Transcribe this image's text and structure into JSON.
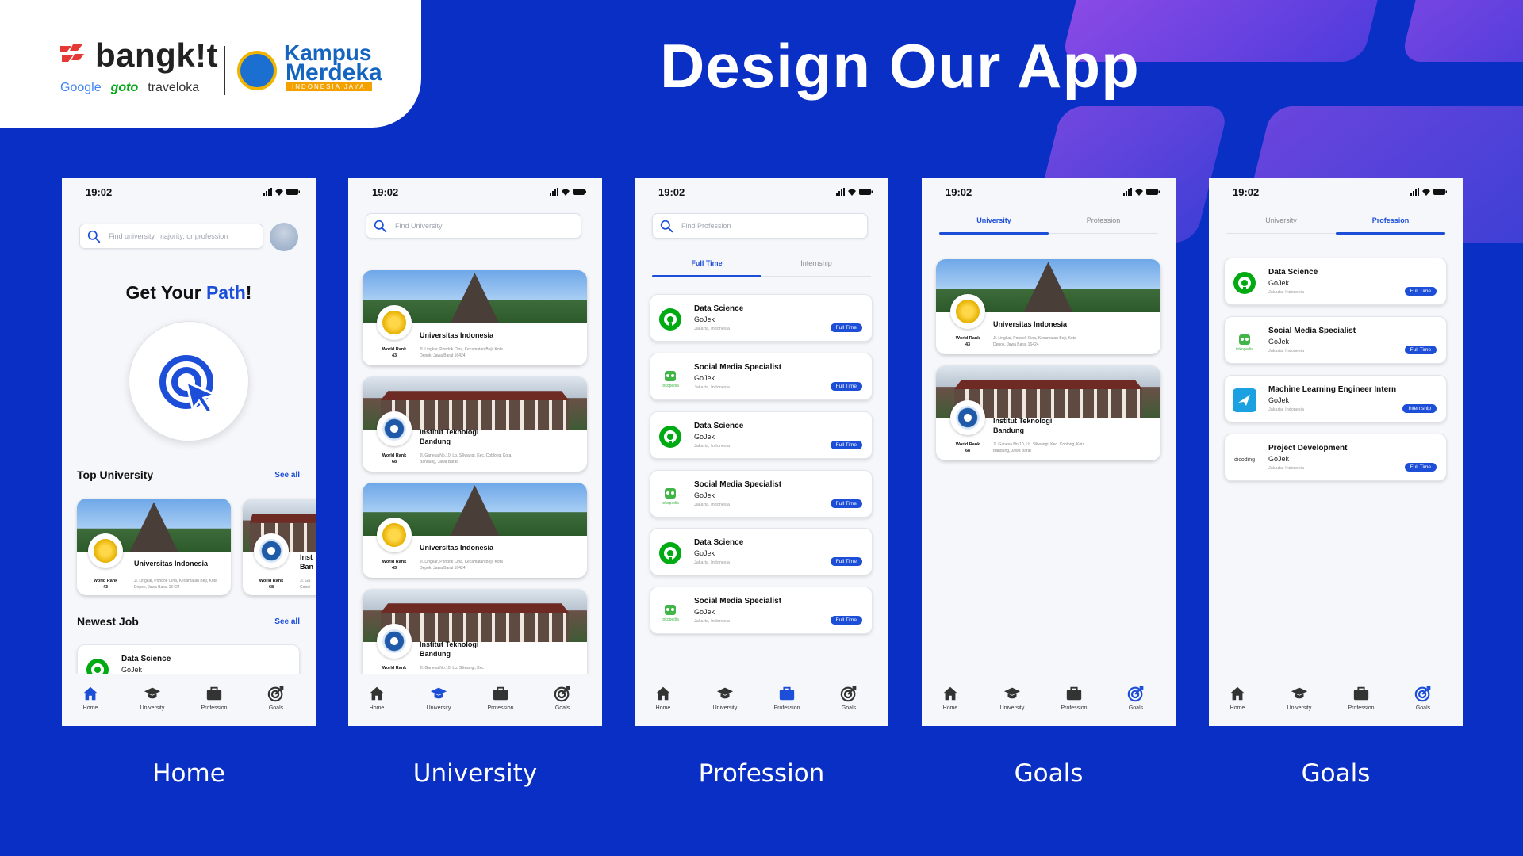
{
  "slide_title": "Design Our App",
  "brand": {
    "bangkit": "bangk!t",
    "partners": [
      "Google",
      "goto",
      "traveloka"
    ],
    "kampus_line1": "Kampus",
    "kampus_line2": "Merdeka",
    "kampus_tagline": "INDONESIA JAYA"
  },
  "colors": {
    "background": "#0a2fc4",
    "accent": "#1d4ed8",
    "badge": "#1d4ed8",
    "goals_gradient": "#8f4be6"
  },
  "common": {
    "time": "19:02",
    "nav": [
      "Home",
      "University",
      "Profession",
      "Goals"
    ],
    "nav_icons": [
      "home-icon",
      "graduation-cap-icon",
      "briefcase-icon",
      "target-icon"
    ]
  },
  "home": {
    "caption": "Home",
    "search_placeholder": "Find university, majority, or profession",
    "headline_a": "Get Your ",
    "headline_b": "Path",
    "headline_c": "!",
    "top_university": "Top University",
    "newest_job": "Newest Job",
    "see_all": "See all",
    "card1": {
      "name": "Universitas Indonesia",
      "rank_label": "World Rank",
      "rank": "43",
      "address": "Jl. Lingkar, Pondok Cina, Kecamatan Beji, Kota Depok, Jawa Barat 16424"
    },
    "card2": {
      "name": "Inst Ban",
      "rank_label": "World Rank",
      "rank": "68",
      "address": "Jl. Ga Coboi"
    },
    "job": {
      "title": "Data Science",
      "company": "GoJek"
    }
  },
  "university": {
    "caption": "University",
    "search_placeholder": "Find University",
    "cards": [
      {
        "name": "Universitas Indonesia",
        "rank_label": "World Rank",
        "rank": "43",
        "address": "Jl. Lingkar, Pondok Cina, Kecamatan Beji, Kota Depok, Jawa Barat 16424"
      },
      {
        "name": "Institut Teknologi Bandung",
        "rank_label": "World Rank",
        "rank": "68",
        "address": "Jl. Ganesa No.10, Lb. Siliwangi, Kec. Coblong, Kota Bandung, Jawa Barat"
      },
      {
        "name": "Universitas Indonesia",
        "rank_label": "World Rank",
        "rank": "43",
        "address": "Jl. Lingkar, Pondok Cina, Kecamatan Beji, Kota Depok, Jawa Barat 16424"
      },
      {
        "name": "Institut Teknologi Bandung",
        "rank_label": "World Rank",
        "rank": "",
        "address": "Jl. Ganesa No.10, Lb. Siliwangi, Kec"
      }
    ]
  },
  "profession": {
    "caption": "Profession",
    "search_placeholder": "Find Profession",
    "tab_full_time": "Full Time",
    "tab_internship": "Internship",
    "jobs": [
      {
        "title": "Data Science",
        "company": "GoJek",
        "location": "Jakarta, Indonesia",
        "badge": "Full Time",
        "logo": "gojek-icon"
      },
      {
        "title": "Social Media Specialist",
        "company": "GoJek",
        "location": "Jakarta, Indonesia",
        "badge": "Full Time",
        "logo": "tokopedia-icon"
      },
      {
        "title": "Data Science",
        "company": "GoJek",
        "location": "Jakarta, Indonesia",
        "badge": "Full Time",
        "logo": "gojek-icon"
      },
      {
        "title": "Social Media Specialist",
        "company": "GoJek",
        "location": "Jakarta, Indonesia",
        "badge": "Full Time",
        "logo": "tokopedia-icon"
      },
      {
        "title": "Data Science",
        "company": "GoJek",
        "location": "Jakarta, Indonesia",
        "badge": "Full Time",
        "logo": "gojek-icon"
      },
      {
        "title": "Social Media Specialist",
        "company": "GoJek",
        "location": "Jakarta, Indonesia",
        "badge": "Full Time",
        "logo": "tokopedia-icon"
      }
    ]
  },
  "goals_university": {
    "caption": "Goals",
    "tab_university": "University",
    "tab_profession": "Profession",
    "cards": [
      {
        "name": "Universitas Indonesia",
        "rank_label": "World Rank",
        "rank": "43",
        "address": "Jl. Lingkar, Pondok Cina, Kecamatan Beji, Kota Depok, Jawa Barat 16424"
      },
      {
        "name": "Institut Teknologi Bandung",
        "rank_label": "World Rank",
        "rank": "68",
        "address": "Jl. Ganesa No.10, Lb. Siliwangi, Kec. Coblong, Kota Bandung, Jawa Barat"
      }
    ]
  },
  "goals_profession": {
    "caption": "Goals",
    "tab_university": "University",
    "tab_profession": "Profession",
    "jobs": [
      {
        "title": "Data Science",
        "company": "GoJek",
        "location": "Jakarta, Indonesia",
        "badge": "Full Time",
        "logo": "gojek-icon"
      },
      {
        "title": "Social Media Specialist",
        "company": "GoJek",
        "location": "Jakarta, Indonesia",
        "badge": "Full Time",
        "logo": "tokopedia-icon"
      },
      {
        "title": "Machine Learning Engineer Intern",
        "company": "GoJek",
        "location": "Jakarta, Indonesia",
        "badge": "Internship",
        "logo": "traveloka-icon"
      },
      {
        "title": "Project Development",
        "company": "GoJek",
        "location": "Jakarta, Indonesia",
        "badge": "Full Time",
        "logo": "dicoding-icon"
      }
    ]
  }
}
